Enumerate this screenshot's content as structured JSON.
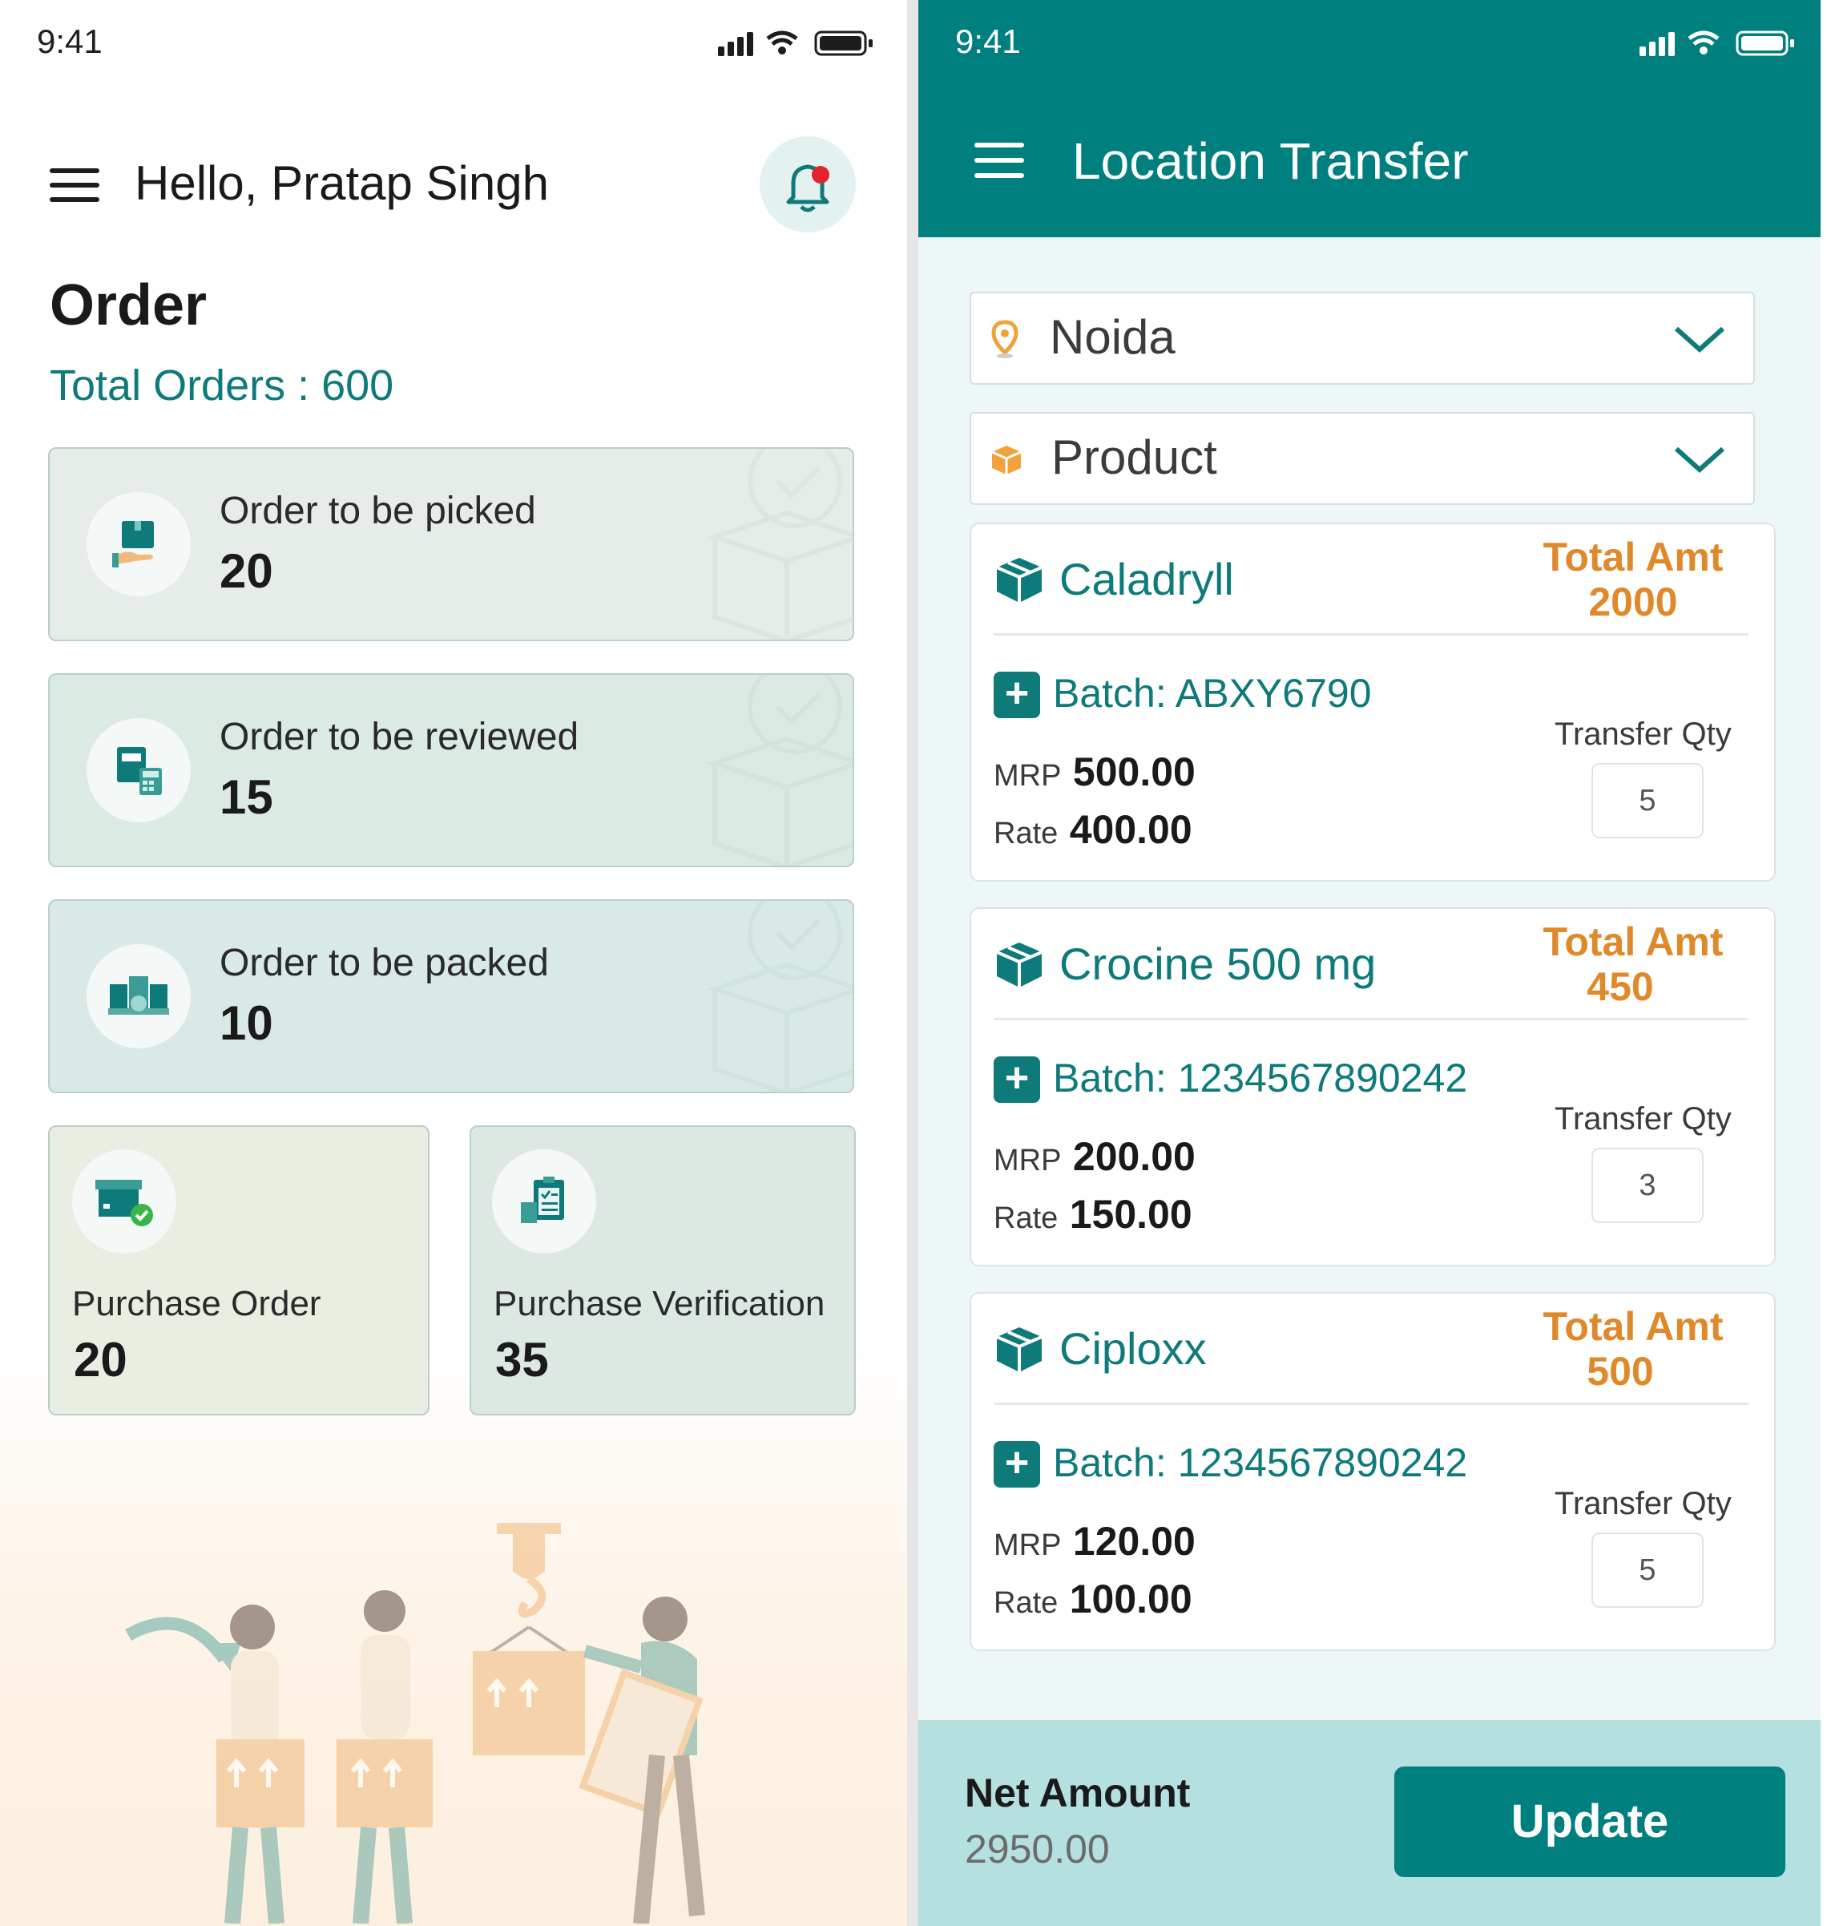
{
  "left": {
    "status_time": "9:41",
    "greeting": "Hello, Pratap Singh",
    "title": "Order",
    "total_orders": "Total Orders : 600",
    "cards": [
      {
        "label": "Order to be picked",
        "count": "20",
        "bg": "#e6ede9"
      },
      {
        "label": "Order to be reviewed",
        "count": "15",
        "bg": "#dbebe3"
      },
      {
        "label": "Order to be packed",
        "count": "10",
        "bg": "#d8e9e8"
      }
    ],
    "small_cards": [
      {
        "label": "Purchase Order",
        "count": "20",
        "bg": "#e8eee2"
      },
      {
        "label": "Purchase Verification",
        "count": "35",
        "bg": "#dde8e3"
      }
    ]
  },
  "right": {
    "status_time": "9:41",
    "title": "Location Transfer",
    "location_select": "Noida",
    "product_select": "Product",
    "products": [
      {
        "name": "Caladryll",
        "total_label": "Total Amt",
        "total": "2000",
        "batch": "Batch: ABXY6790",
        "mrp_label": "MRP",
        "mrp": "500.00",
        "rate_label": "Rate",
        "rate": "400.00",
        "qty_label": "Transfer Qty",
        "qty": "5"
      },
      {
        "name": "Crocine 500 mg",
        "total_label": "Total Amt",
        "total": "450",
        "batch": "Batch: 1234567890242",
        "mrp_label": "MRP",
        "mrp": "200.00",
        "rate_label": "Rate",
        "rate": "150.00",
        "qty_label": "Transfer Qty",
        "qty": "3"
      },
      {
        "name": "Ciploxx",
        "total_label": "Total Amt",
        "total": "500",
        "batch": "Batch: 1234567890242",
        "mrp_label": "MRP",
        "mrp": "120.00",
        "rate_label": "Rate",
        "rate": "100.00",
        "qty_label": "Transfer Qty",
        "qty": "5"
      }
    ],
    "net_amount_label": "Net Amount",
    "net_amount": "2950.00",
    "update_label": "Update"
  },
  "colors": {
    "teal": "#007f7f",
    "teal_text": "#0e7a7a",
    "orange": "#e0892a",
    "footer": "#b5e0e0"
  }
}
